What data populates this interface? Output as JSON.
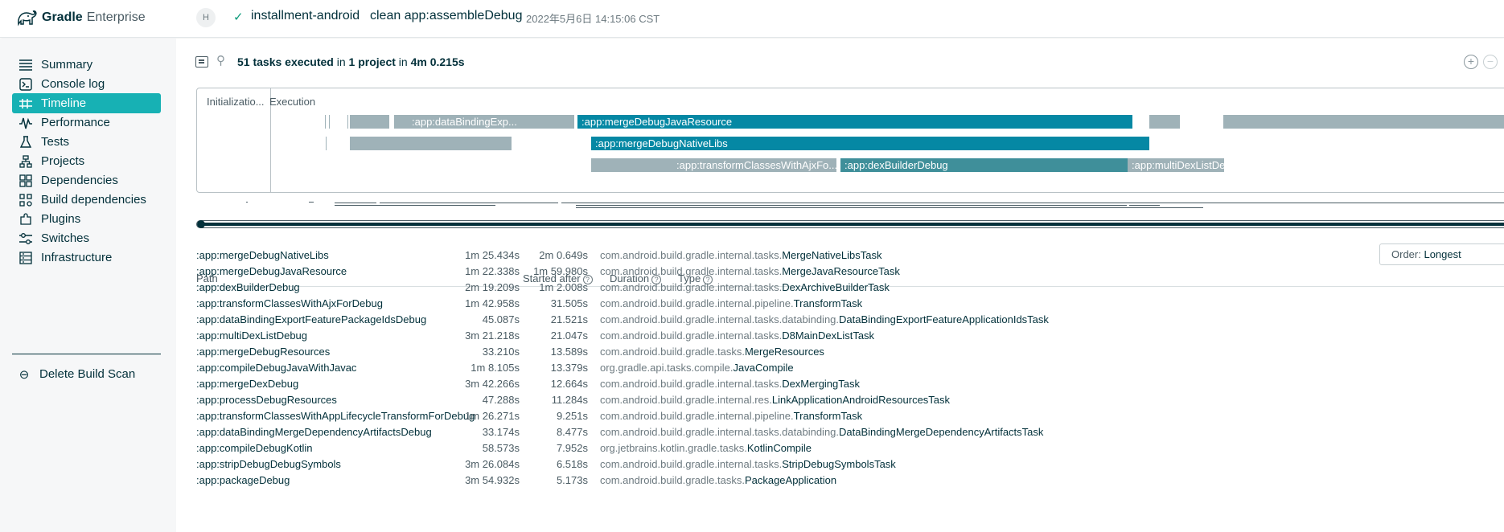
{
  "header": {
    "brand_bold": "Gradle",
    "brand_light": "Enterprise",
    "avatar_initial": "H",
    "project": "installment-android",
    "command": "clean app:assembleDebug",
    "date": "2022年5月6日 14:15:06 CST"
  },
  "sidebar": {
    "items": [
      {
        "label": "Summary",
        "icon": "summary-icon"
      },
      {
        "label": "Console log",
        "icon": "console-log-icon"
      },
      {
        "label": "Timeline",
        "icon": "timeline-icon",
        "active": true
      },
      {
        "label": "Performance",
        "icon": "performance-icon"
      },
      {
        "label": "Tests",
        "icon": "tests-icon"
      },
      {
        "label": "Projects",
        "icon": "projects-icon"
      },
      {
        "label": "Dependencies",
        "icon": "dependencies-icon"
      },
      {
        "label": "Build dependencies",
        "icon": "build-dependencies-icon"
      },
      {
        "label": "Plugins",
        "icon": "plugins-icon"
      },
      {
        "label": "Switches",
        "icon": "switches-icon"
      },
      {
        "label": "Infrastructure",
        "icon": "infrastructure-icon"
      }
    ],
    "delete_label": "Delete Build Scan"
  },
  "summary": {
    "tasks": "51 tasks executed",
    "in1": "in",
    "project": "1 project",
    "in2": "in",
    "duration": "4m 0.215s"
  },
  "timeline": {
    "phase_init": "Initializatio...",
    "phase_exec": "Execution",
    "bars": {
      "b1": ":app:dataBindingExp...",
      "b2": ":app:mergeDebugJavaResource",
      "b3": ":app:mergeDebugNativeLibs",
      "b4": ":app:transformClassesWithAjxFo...",
      "b5": ":app:dexBuilderDebug",
      "b6": ":app:multiDexListDe..."
    }
  },
  "order": {
    "label": "Order:",
    "value": "Longest"
  },
  "table": {
    "headers": {
      "path": "Path",
      "started": "Started after",
      "duration": "Duration",
      "type": "Type"
    },
    "rows": [
      {
        "path": ":app:mergeDebugNativeLibs",
        "start": "1m 25.434s",
        "dur": "2m 0.649s",
        "pkg": "com.android.build.gradle.internal.tasks.",
        "cls": "MergeNativeLibsTask"
      },
      {
        "path": ":app:mergeDebugJavaResource",
        "start": "1m 22.338s",
        "dur": "1m 59.980s",
        "pkg": "com.android.build.gradle.internal.tasks.",
        "cls": "MergeJavaResourceTask"
      },
      {
        "path": ":app:dexBuilderDebug",
        "start": "2m 19.209s",
        "dur": "1m 2.008s",
        "pkg": "com.android.build.gradle.internal.tasks.",
        "cls": "DexArchiveBuilderTask"
      },
      {
        "path": ":app:transformClassesWithAjxForDebug",
        "start": "1m 42.958s",
        "dur": "31.505s",
        "pkg": "com.android.build.gradle.internal.pipeline.",
        "cls": "TransformTask"
      },
      {
        "path": ":app:dataBindingExportFeaturePackageIdsDebug",
        "start": "45.087s",
        "dur": "21.521s",
        "pkg": "com.android.build.gradle.internal.tasks.databinding.",
        "cls": "DataBindingExportFeatureApplicationIdsTask"
      },
      {
        "path": ":app:multiDexListDebug",
        "start": "3m 21.218s",
        "dur": "21.047s",
        "pkg": "com.android.build.gradle.internal.tasks.",
        "cls": "D8MainDexListTask"
      },
      {
        "path": ":app:mergeDebugResources",
        "start": "33.210s",
        "dur": "13.589s",
        "pkg": "com.android.build.gradle.tasks.",
        "cls": "MergeResources"
      },
      {
        "path": ":app:compileDebugJavaWithJavac",
        "start": "1m 8.105s",
        "dur": "13.379s",
        "pkg": "org.gradle.api.tasks.compile.",
        "cls": "JavaCompile"
      },
      {
        "path": ":app:mergeDexDebug",
        "start": "3m 42.266s",
        "dur": "12.664s",
        "pkg": "com.android.build.gradle.internal.tasks.",
        "cls": "DexMergingTask"
      },
      {
        "path": ":app:processDebugResources",
        "start": "47.288s",
        "dur": "11.284s",
        "pkg": "com.android.build.gradle.internal.res.",
        "cls": "LinkApplicationAndroidResourcesTask"
      },
      {
        "path": ":app:transformClassesWithAppLifecycleTransformForDebug",
        "start": "1m 26.271s",
        "dur": "9.251s",
        "pkg": "com.android.build.gradle.internal.pipeline.",
        "cls": "TransformTask"
      },
      {
        "path": ":app:dataBindingMergeDependencyArtifactsDebug",
        "start": "33.174s",
        "dur": "8.477s",
        "pkg": "com.android.build.gradle.internal.tasks.databinding.",
        "cls": "DataBindingMergeDependencyArtifactsTask"
      },
      {
        "path": ":app:compileDebugKotlin",
        "start": "58.573s",
        "dur": "7.952s",
        "pkg": "org.jetbrains.kotlin.gradle.tasks.",
        "cls": "KotlinCompile"
      },
      {
        "path": ":app:stripDebugDebugSymbols",
        "start": "3m 26.084s",
        "dur": "6.518s",
        "pkg": "com.android.build.gradle.internal.tasks.",
        "cls": "StripDebugSymbolsTask"
      },
      {
        "path": ":app:packageDebug",
        "start": "3m 54.932s",
        "dur": "5.173s",
        "pkg": "com.android.build.gradle.tasks.",
        "cls": "PackageApplication"
      }
    ]
  },
  "colors": {
    "accent": "#17b1b4",
    "bar_dark": "#0588a4",
    "bar_light": "#9fb2b8",
    "text": "#02303a"
  }
}
